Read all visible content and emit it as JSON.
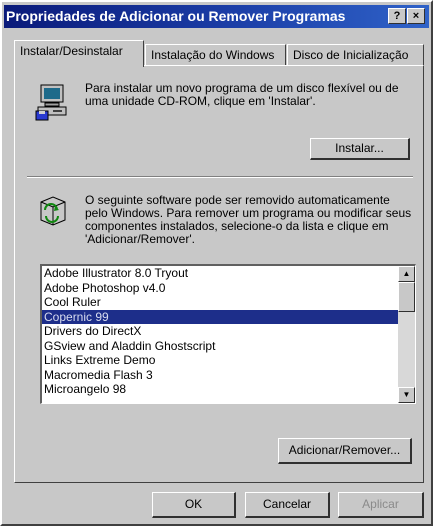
{
  "window": {
    "title": "Propriedades de Adicionar ou Remover Programas",
    "help_label": "?",
    "close_label": "×"
  },
  "tabs": [
    {
      "label": "Instalar/Desinstalar"
    },
    {
      "label": "Instalação do Windows"
    },
    {
      "label": "Disco de Inicialização"
    }
  ],
  "install": {
    "text": "Para instalar um novo programa de um disco flexível ou de uma unidade CD-ROM, clique em 'Instalar'.",
    "button_label": "Instalar..."
  },
  "remove": {
    "text": "O seguinte software pode ser removido automaticamente pelo Windows. Para remover um programa ou modificar seus componentes instalados, selecione-o da lista e clique em 'Adicionar/Remover'.",
    "button_label": "Adicionar/Remover..."
  },
  "programs": [
    "Adobe Illustrator 8.0 Tryout",
    "Adobe Photoshop v4.0",
    "Cool Ruler",
    "Copernic 99",
    "Drivers do DirectX",
    "GSview and Aladdin Ghostscript",
    "Links Extreme Demo",
    "Macromedia Flash 3",
    "Microangelo 98"
  ],
  "selected_program": "Copernic 99",
  "footer": {
    "ok_label": "OK",
    "cancel_label": "Cancelar",
    "apply_label": "Aplicar"
  }
}
